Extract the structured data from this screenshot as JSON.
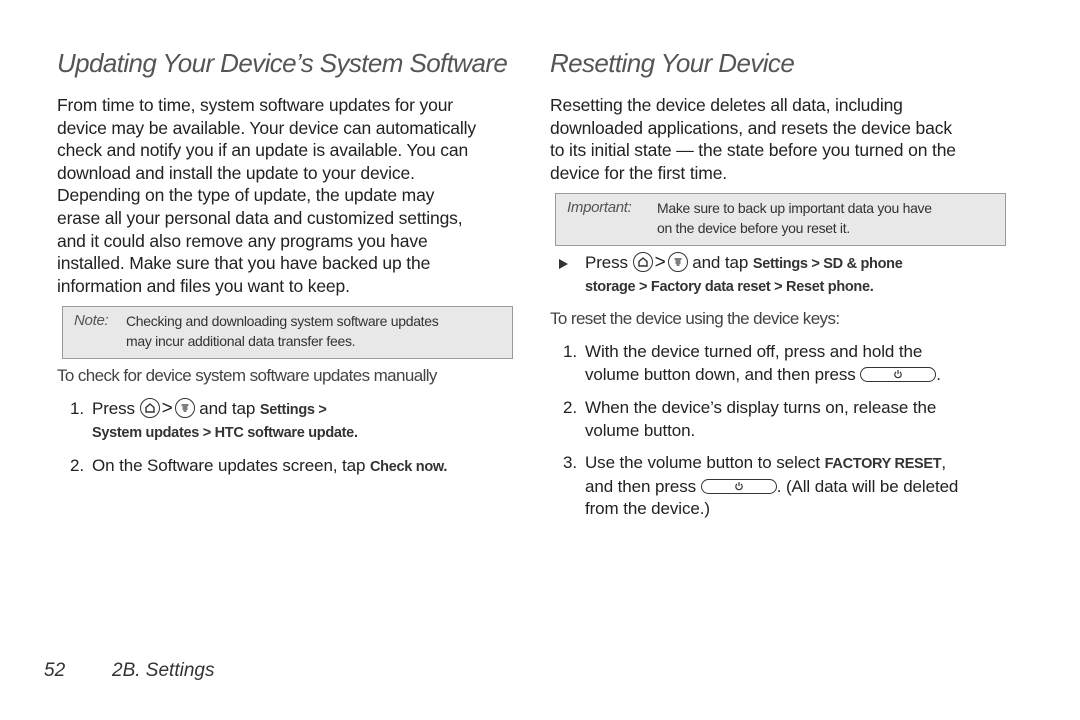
{
  "left": {
    "heading": "Updating Your Device’s System Software",
    "body_lines": [
      "From time to time, system software updates for your",
      "device may be available. Your device can automatically",
      "check and notify you if an update is available. You can",
      "download and install the update to your device.",
      "Depending on the type of update, the update may",
      "erase all your personal data and customized settings,",
      "and it could also remove any programs you have",
      "installed. Make sure that you have backed up the",
      "information and files you want to keep."
    ],
    "note": {
      "label": "Note:",
      "lines": [
        "Checking and downloading system software updates",
        "may incur additional data transfer fees."
      ]
    },
    "procedure_title": "To check for device system software updates manually",
    "steps": [
      {
        "num": "1.",
        "press": "Press",
        "gt": ">",
        "and_tap": "and tap",
        "path_line1": "Settings >",
        "path_line2": "System updates > HTC software update."
      },
      {
        "num": "2.",
        "text": "On the Software updates screen, tap",
        "bold": "Check now."
      }
    ]
  },
  "right": {
    "heading": "Resetting Your Device",
    "body_lines": [
      "Resetting the device deletes all data, including",
      "downloaded applications, and resets the device back",
      "to its initial state — the state before you turned on the",
      "device for the first time."
    ],
    "important": {
      "label": "Important:",
      "lines": [
        "Make sure to back up important data you have",
        "on the device before you reset it."
      ]
    },
    "bullet": {
      "press": "Press",
      "gt": ">",
      "and_tap": "and tap",
      "path_line1": "Settings > SD & phone",
      "path_line2": "storage > Factory data reset > Reset phone."
    },
    "procedure_title": "To reset the device using the device keys:",
    "steps": [
      {
        "num": "1.",
        "line1": "With the device turned off, press and hold the",
        "line2_before": "volume button down, and then press",
        "line2_after": "."
      },
      {
        "num": "2.",
        "line1": "When the device’s display turns on, release the",
        "line2": "volume button."
      },
      {
        "num": "3.",
        "line1_before": "Use the volume button to select",
        "line1_bold": "FACTORY RESET",
        "line1_after": ",",
        "line2_before": "and then press",
        "line2_after": ". (All data will be deleted",
        "line3": "from the device.)"
      }
    ]
  },
  "footer": {
    "page_number": "52",
    "section": "2B. Settings"
  }
}
